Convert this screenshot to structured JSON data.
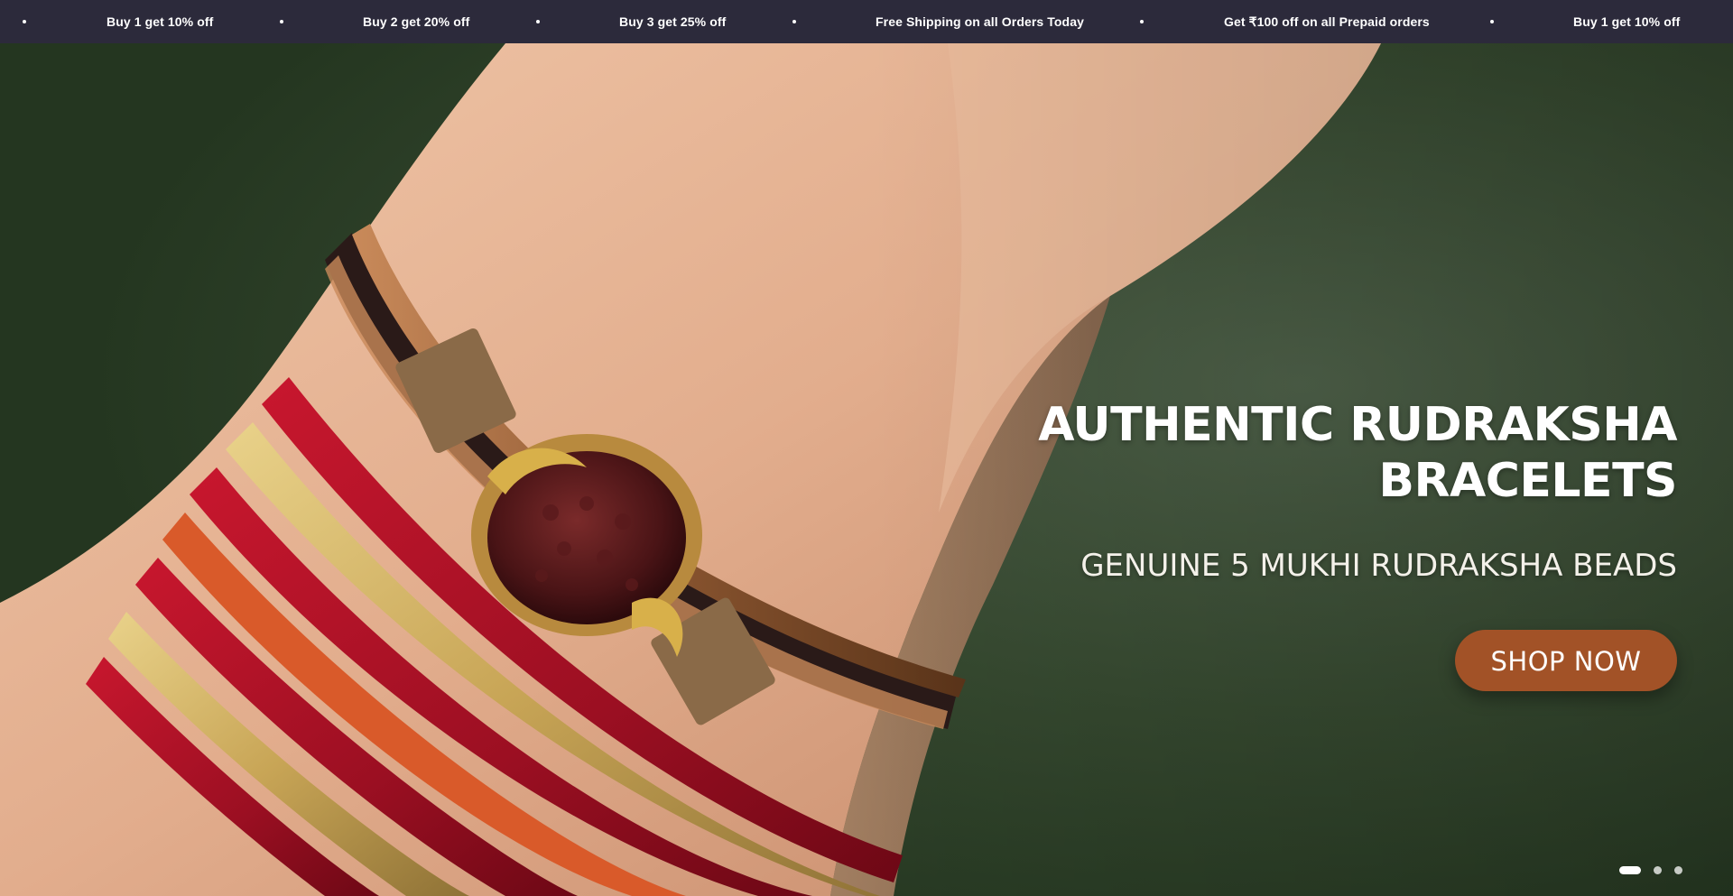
{
  "announcement_bar": {
    "items": [
      "Buy 1 get 10% off",
      "Buy 2 get 20% off",
      "Buy 3 get 25% off",
      "Free Shipping on all Orders Today",
      "Get ₹100 off on all Prepaid orders",
      "Buy 1 get 10% off"
    ],
    "background": "#2c2a3b",
    "text_color": "#ffffff"
  },
  "hero": {
    "heading_line1": "AUTHENTIC RUDRAKSHA",
    "heading_line2": "BRACELETS",
    "subheading": "GENUINE 5 MUKHI RUDRAKSHA BEADS",
    "cta_label": "SHOP NOW",
    "cta_color": "#a25227",
    "image_subject": "rudraksha-bracelet-on-wrist-with-red-bangles"
  },
  "slider": {
    "slide_count": 3,
    "active_slide": 1
  }
}
